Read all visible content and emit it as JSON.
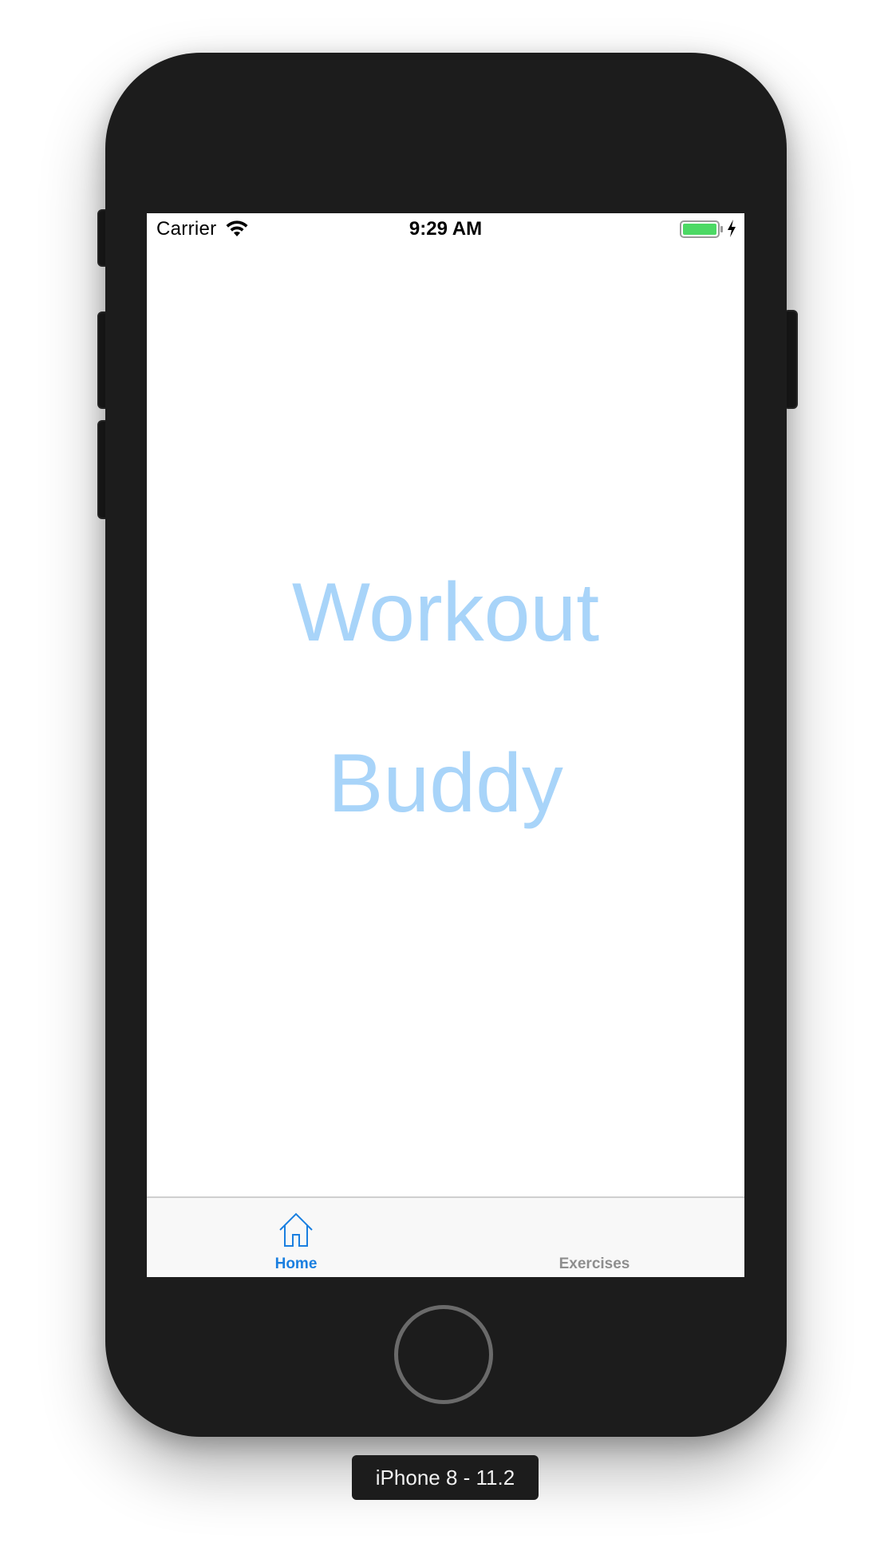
{
  "status_bar": {
    "carrier": "Carrier",
    "time": "9:29 AM",
    "battery_color": "#4cd964"
  },
  "app": {
    "title_line_1": "Workout",
    "title_line_2": "Buddy",
    "title_color": "#a8d4f9"
  },
  "tab_bar": {
    "tabs": [
      {
        "label": "Home",
        "icon": "house-icon",
        "selected": true,
        "color": "#1a7fe0"
      },
      {
        "label": "Exercises",
        "icon": "",
        "selected": false,
        "color": "#8e8e8e"
      }
    ]
  },
  "simulator": {
    "device_label": "iPhone 8 - 11.2"
  }
}
